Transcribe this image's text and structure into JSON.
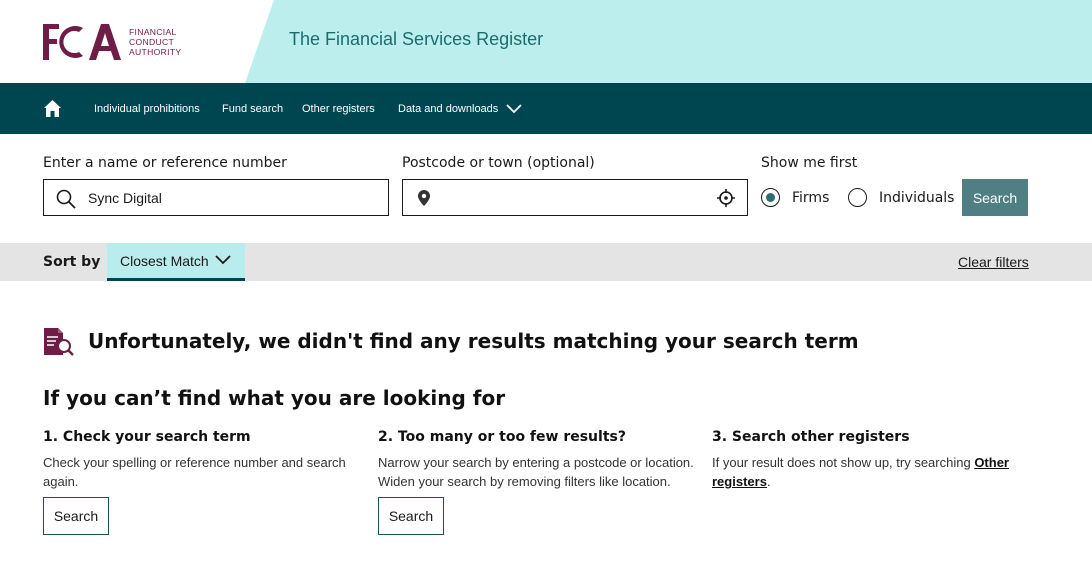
{
  "header": {
    "logo_letters": "FCA",
    "logo_text": [
      "FINANCIAL",
      "CONDUCT",
      "AUTHORITY"
    ],
    "title": "The Financial Services Register"
  },
  "nav": {
    "home_icon": "home-icon",
    "items": [
      {
        "label": "Individual prohibitions"
      },
      {
        "label": "Fund search"
      },
      {
        "label": "Other registers"
      },
      {
        "label": "Data and downloads"
      }
    ]
  },
  "search": {
    "name_label": "Enter a name or reference number",
    "name_value": "Sync Digital",
    "postcode_label": "Postcode or town (optional)",
    "postcode_value": "",
    "show_first_label": "Show me first",
    "options": [
      {
        "label": "Firms",
        "checked": true
      },
      {
        "label": "Individuals",
        "checked": false
      }
    ],
    "button_label": "Search"
  },
  "sort": {
    "label": "Sort by",
    "selected": "Closest Match",
    "clear_label": "Clear filters"
  },
  "results": {
    "message": "Unfortunately, we didn't find any results matching your search term"
  },
  "help": {
    "heading": "If you can’t find what you are looking for",
    "columns": [
      {
        "title": "1. Check your search term",
        "body": "Check your spelling or reference number and search again.",
        "button": "Search"
      },
      {
        "title": "2. Too many or too few results?",
        "body": "Narrow your search by entering a postcode or location. Widen your search by removing filters like location.",
        "button": "Search"
      },
      {
        "title": "3. Search other registers",
        "body_prefix": "If your result does not show up, try searching ",
        "link": "Other registers",
        "body_suffix": "."
      }
    ]
  },
  "colors": {
    "brand": "#6f1d46",
    "nav_bg": "#004650",
    "header_accent": "#bdeeee",
    "button_bg": "#4f7f82"
  }
}
